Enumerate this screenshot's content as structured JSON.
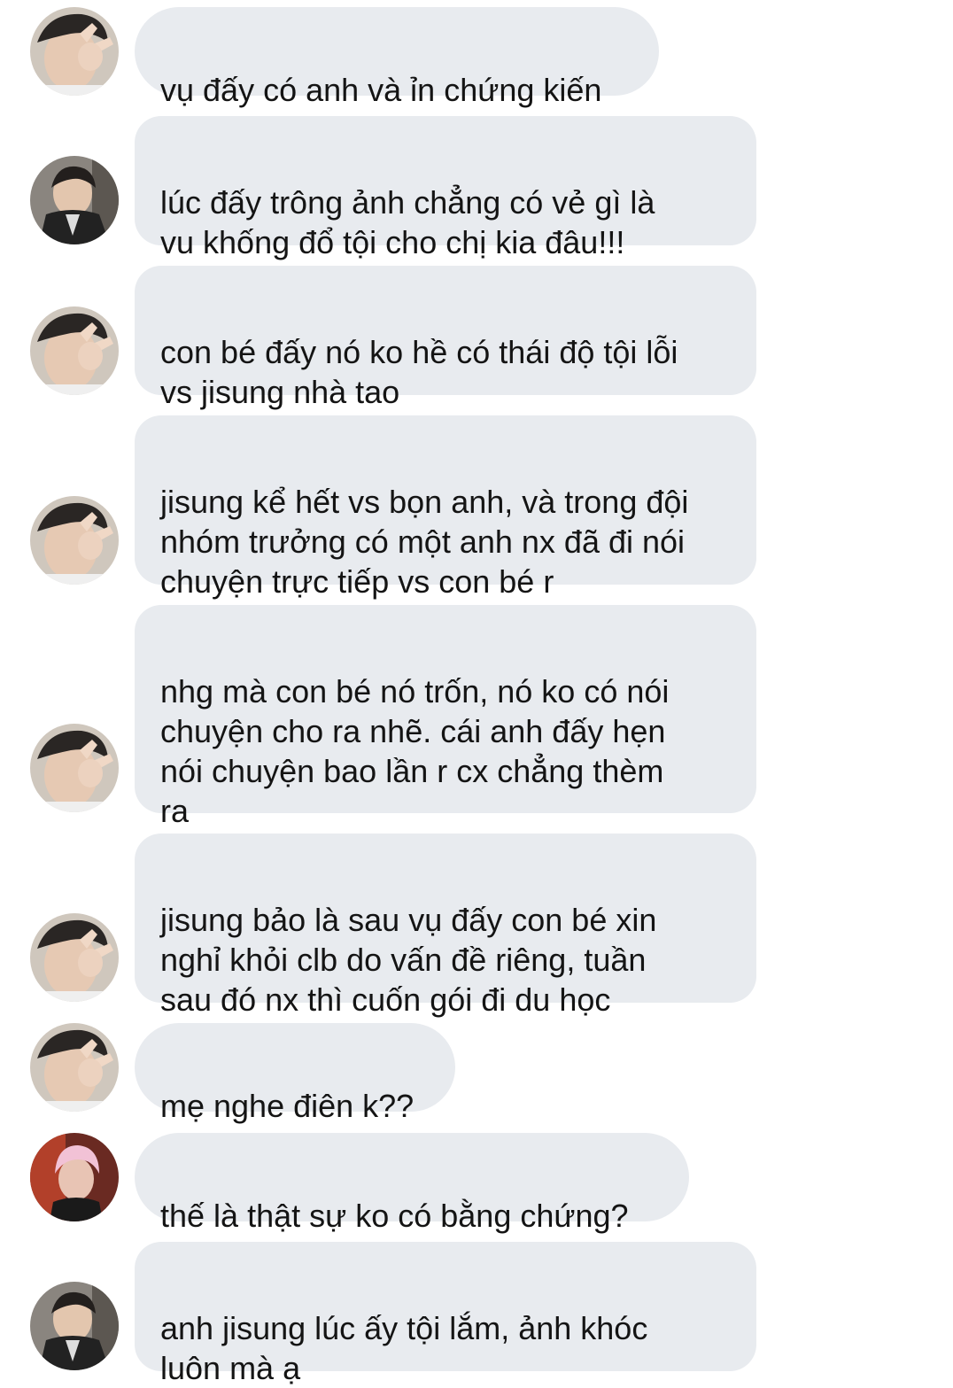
{
  "messages": [
    {
      "sender": "hand-avatar",
      "text": "vụ đấy có anh và ỉn chứng kiến"
    },
    {
      "sender": "jacket-avatar",
      "text": "lúc đấy trông ảnh chẳng có vẻ gì là\nvu khống đổ tội cho chị kia đâu!!!"
    },
    {
      "sender": "hand-avatar",
      "text": "con bé đấy nó ko hề có thái độ tội lỗi\nvs jisung nhà tao"
    },
    {
      "sender": "hand-avatar",
      "text": "jisung kể hết vs bọn anh, và trong đội\nnhóm trưởng có một anh nx đã đi nói\nchuyện trực tiếp vs con bé r"
    },
    {
      "sender": "hand-avatar",
      "text": "nhg mà con bé nó trốn, nó ko có nói\nchuyện cho ra nhẽ. cái anh đấy hẹn\nnói chuyện bao lần r cx chẳng thèm\nra"
    },
    {
      "sender": "hand-avatar",
      "text": "jisung bảo là sau vụ đấy con bé xin\nnghỉ khỏi clb do vấn đề riêng, tuần\nsau đó nx thì cuốn gói đi du học"
    },
    {
      "sender": "hand-avatar",
      "text": "mẹ nghe điên k??"
    },
    {
      "sender": "pink-hair-avatar",
      "text": "thế là thật sự ko có bằng chứng?"
    },
    {
      "sender": "jacket-avatar",
      "text": "anh jisung lúc ấy tội lắm, ảnh khóc\nluôn mà ạ"
    }
  ]
}
